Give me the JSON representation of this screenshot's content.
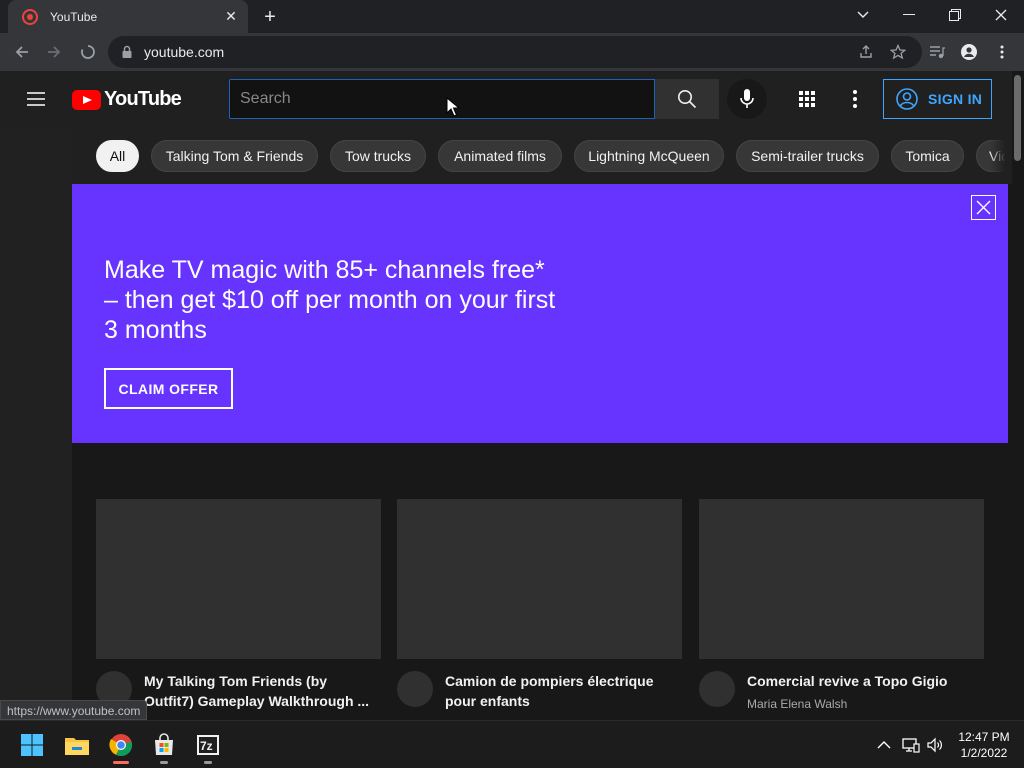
{
  "browser": {
    "tab_title": "YouTube",
    "address": "youtube.com",
    "status_url": "https://www.youtube.com"
  },
  "youtube": {
    "logo_text": "YouTube",
    "search_placeholder": "Search",
    "sign_in_label": "SIGN IN",
    "chips": [
      "All",
      "Talking Tom & Friends",
      "Tow trucks",
      "Animated films",
      "Lightning McQueen",
      "Semi-trailer trucks",
      "Tomica",
      "Vid"
    ],
    "promo": {
      "text": "Make TV magic with 85+ channels free* – then get $10 off per month on your first 3 months",
      "button": "CLAIM OFFER",
      "background": "#6633ff"
    },
    "videos": [
      {
        "title": "My Talking Tom Friends (by Outfit7) Gameplay Walkthrough ...",
        "channel": ""
      },
      {
        "title": "Camion de pompiers électrique pour enfants",
        "channel": ""
      },
      {
        "title": "Comercial revive a Topo Gigio",
        "channel": "Maria Elena Walsh"
      }
    ]
  },
  "taskbar": {
    "time": "12:47 PM",
    "date": "1/2/2022",
    "apps": [
      "windows-start-icon",
      "file-explorer-icon",
      "chrome-icon",
      "microsoft-store-icon",
      "7zip-icon"
    ]
  },
  "colors": {
    "accent_blue": "#3ea6ff",
    "youtube_red": "#ff0000"
  }
}
